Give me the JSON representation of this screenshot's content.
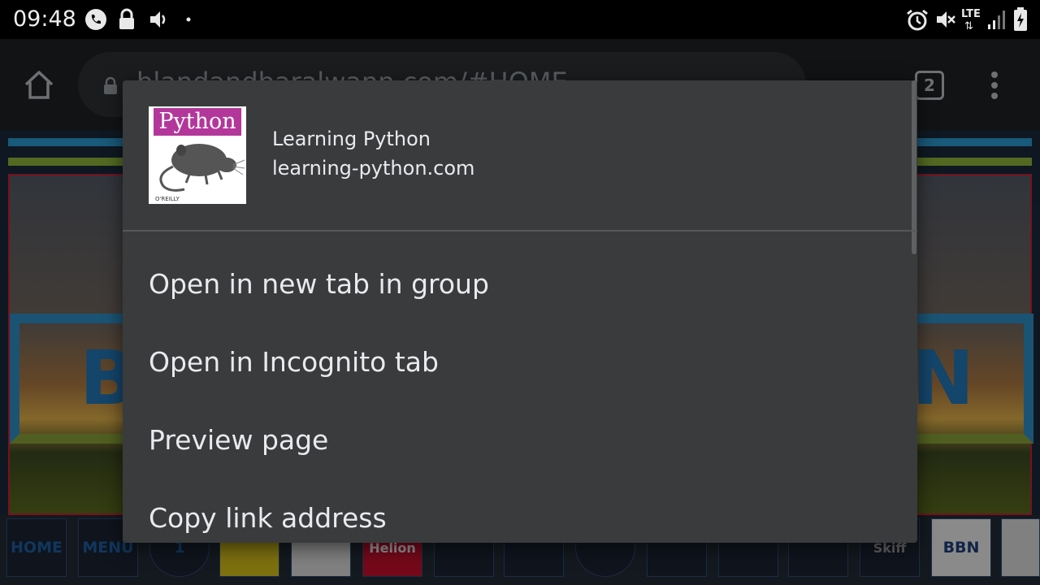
{
  "status_bar": {
    "time": "09:48",
    "network": "LTE",
    "icons": [
      "phone-icon",
      "lock-icon",
      "volume-icon",
      "dot-icon",
      "alarm-icon",
      "mute-icon",
      "signal-icon",
      "battery-charging-icon"
    ]
  },
  "toolbar": {
    "url": "blandandbaralwann.com/#HOME",
    "tab_count": "2",
    "icons": [
      "home-icon",
      "lock-icon",
      "menu-icon"
    ]
  },
  "page": {
    "bottom_tiles": [
      "HOME",
      "MENU",
      "1",
      "",
      "",
      "Helion",
      "",
      "",
      "",
      "",
      "",
      "",
      "Skiff",
      "BBN",
      ""
    ]
  },
  "context_menu": {
    "link_title": "Learning Python",
    "link_domain": "learning-python.com",
    "thumbnail_text": "Python",
    "thumbnail_publisher": "O'REILLY",
    "items": [
      {
        "label": "Open in new tab in group"
      },
      {
        "label": "Open in Incognito tab"
      },
      {
        "label": "Preview page"
      },
      {
        "label": "Copy link address"
      }
    ]
  },
  "colors": {
    "dialog_bg": "#3a3b3d",
    "text": "#e8eaed",
    "thumbnail_accent": "#b3379a"
  }
}
